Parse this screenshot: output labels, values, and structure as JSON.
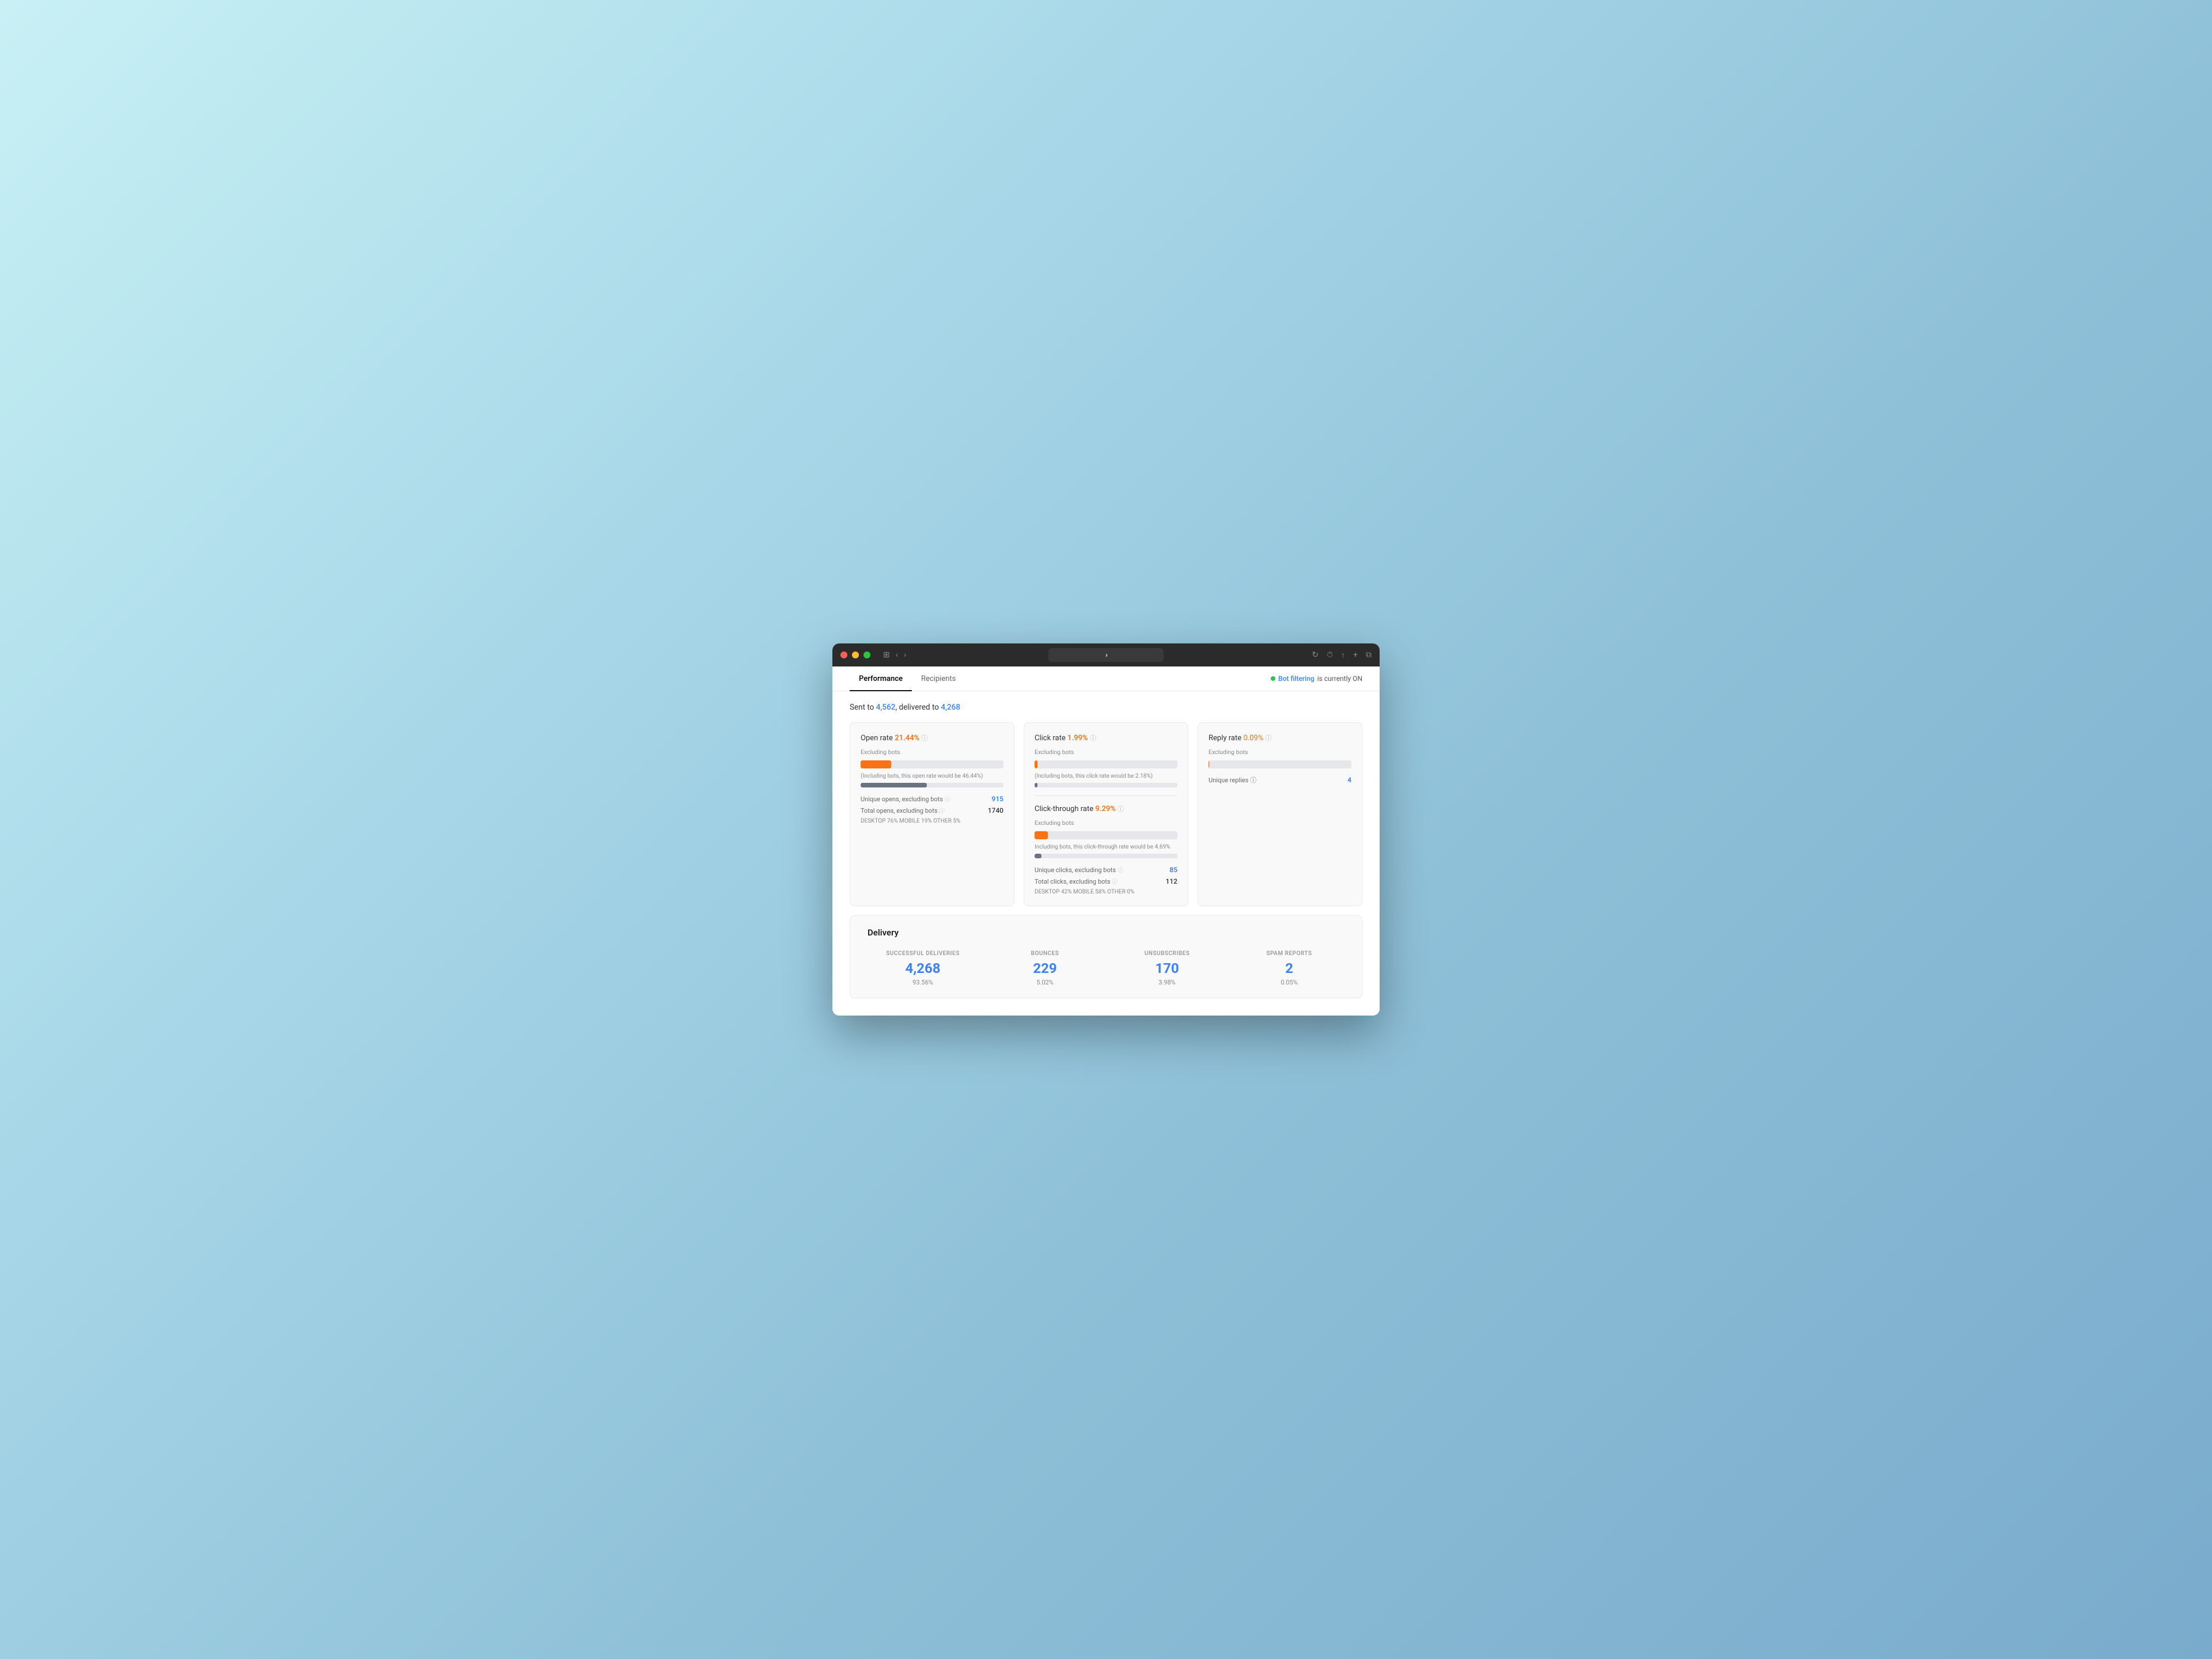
{
  "browser": {
    "traffic_lights": [
      "red",
      "yellow",
      "green"
    ],
    "nav_back": "‹",
    "nav_forward": "›",
    "sidebar_icon": "⊞",
    "refresh_icon": "↻",
    "clock_icon": "⏱",
    "share_icon": "↑",
    "new_tab_icon": "+",
    "tabs_icon": "⧉"
  },
  "tabs": [
    {
      "label": "Performance",
      "active": true
    },
    {
      "label": "Recipients",
      "active": false
    }
  ],
  "bot_filtering": {
    "dot_color": "#22c55e",
    "link_text": "Bot filtering",
    "suffix": " is currently ON"
  },
  "header": {
    "sent_prefix": "Sent to ",
    "sent_value": "4,562",
    "delivered_prefix": ", delivered to ",
    "delivered_value": "4,268"
  },
  "open_rate_card": {
    "label": "Open rate",
    "value": "21.44%",
    "excluding_bots": "Excluding bots",
    "bar_pct": 21.44,
    "including_bots_note": "(Including bots, this open rate would be 46.44%)",
    "including_bots_pct": 46.44,
    "unique_opens_label": "Unique opens, excluding bots",
    "unique_opens_value": "915",
    "total_opens_label": "Total opens, excluding bots",
    "total_opens_value": "1740",
    "device_breakdown": "DESKTOP 76%  MOBILE 19%  OTHER 5%"
  },
  "click_rate_card": {
    "click_rate_label": "Click rate",
    "click_rate_value": "1.99%",
    "click_rate_bar_pct": 1.99,
    "click_excluding_bots": "Excluding bots",
    "click_including_bots_note": "(Including bots, this click rate would be 2.18%)",
    "click_including_bots_pct": 2.18,
    "ctr_label": "Click-through rate",
    "ctr_value": "9.29%",
    "ctr_excluding_bots": "Excluding bots",
    "ctr_bar_pct": 9.29,
    "ctr_including_bots_note": "Including bots, this click-through rate would be 4.69%",
    "ctr_including_bots_pct": 4.69,
    "unique_clicks_label": "Unique clicks, excluding bots",
    "unique_clicks_value": "85",
    "total_clicks_label": "Total clicks, excluding bots",
    "total_clicks_value": "112",
    "device_breakdown": "DESKTOP 42%  MOBILE 58%  OTHER 0%"
  },
  "reply_rate_card": {
    "label": "Reply rate",
    "value": "0.09%",
    "bar_pct": 0.09,
    "excluding_bots": "Excluding bots",
    "unique_replies_label": "Unique replies",
    "unique_replies_value": "4"
  },
  "delivery": {
    "title": "Delivery",
    "stats": [
      {
        "label": "SUCCESSFUL DELIVERIES",
        "value": "4,268",
        "pct": "93.56%"
      },
      {
        "label": "BOUNCES",
        "value": "229",
        "pct": "5.02%"
      },
      {
        "label": "UNSUBSCRIBES",
        "value": "170",
        "pct": "3.98%"
      },
      {
        "label": "SPAM REPORTS",
        "value": "2",
        "pct": "0.05%"
      }
    ]
  },
  "colors": {
    "accent_blue": "#3b82f6",
    "accent_orange": "#f97316",
    "progress_orange": "#f97316",
    "progress_gray": "#6b7280",
    "progress_bg": "#e5e7eb",
    "green_dot": "#22c55e"
  }
}
